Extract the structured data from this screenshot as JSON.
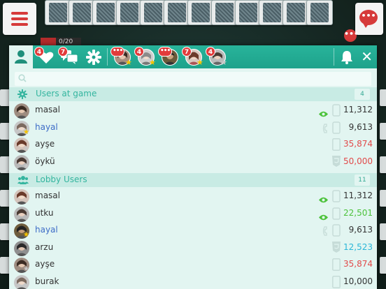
{
  "game": {
    "counter": "0/20",
    "chat_badge": "•••",
    "more_badge": "•••"
  },
  "tabs": {
    "favorites_badge": "4",
    "messages_badge": "7",
    "conversations": [
      {
        "badge": "•••",
        "star": "gold"
      },
      {
        "badge": "4",
        "star": "gold"
      },
      {
        "badge": "•••",
        "star": "none"
      },
      {
        "badge": "7",
        "star": "gold"
      },
      {
        "badge": "4",
        "star": "grey"
      }
    ]
  },
  "search": {
    "placeholder": ""
  },
  "sections": [
    {
      "title": "Users at game",
      "count": "4",
      "users": [
        {
          "name": "masal",
          "score": "11,312",
          "score_color": "black",
          "name_color": "black",
          "device": "phone",
          "extra": "eye",
          "star": "none"
        },
        {
          "name": "hayal",
          "score": "9,613",
          "score_color": "black",
          "name_color": "blue",
          "device": "phone",
          "extra": "call",
          "star": "gold"
        },
        {
          "name": "ayşe",
          "score": "35,874",
          "score_color": "red",
          "name_color": "black",
          "device": "tablet",
          "extra": "",
          "star": "grey"
        },
        {
          "name": "öykü",
          "score": "50,000",
          "score_color": "red",
          "name_color": "black",
          "device": "html5",
          "extra": "",
          "star": "grey"
        }
      ]
    },
    {
      "title": "Lobby Users",
      "count": "11",
      "users": [
        {
          "name": "masal",
          "score": "11,312",
          "score_color": "black",
          "name_color": "black",
          "device": "phone",
          "extra": "eye",
          "star": "none"
        },
        {
          "name": "utku",
          "score": "22,501",
          "score_color": "green",
          "name_color": "black",
          "device": "phone",
          "extra": "eye",
          "star": "none"
        },
        {
          "name": "hayal",
          "score": "9,613",
          "score_color": "black",
          "name_color": "blue",
          "device": "phone",
          "extra": "call",
          "star": "gold"
        },
        {
          "name": "arzu",
          "score": "12,523",
          "score_color": "cyan",
          "name_color": "black",
          "device": "html5",
          "extra": "",
          "star": "none"
        },
        {
          "name": "ayşe",
          "score": "35,874",
          "score_color": "red",
          "name_color": "black",
          "device": "tablet",
          "extra": "",
          "star": "grey"
        },
        {
          "name": "burak",
          "score": "10,000",
          "score_color": "black",
          "name_color": "black",
          "device": "tablet",
          "extra": "",
          "star": "none"
        }
      ]
    }
  ],
  "colors": {
    "accent": "#1ea28b",
    "panel": "#e2f5f1",
    "section": "#c8ebe4",
    "badge": "#e23b3b"
  },
  "icons": {
    "tab_users": "user-icon",
    "tab_favorites": "heart-icon",
    "tab_messages": "chat-icon",
    "tab_settings": "gear-icon",
    "notifications": "bell-icon",
    "close": "close-icon"
  }
}
